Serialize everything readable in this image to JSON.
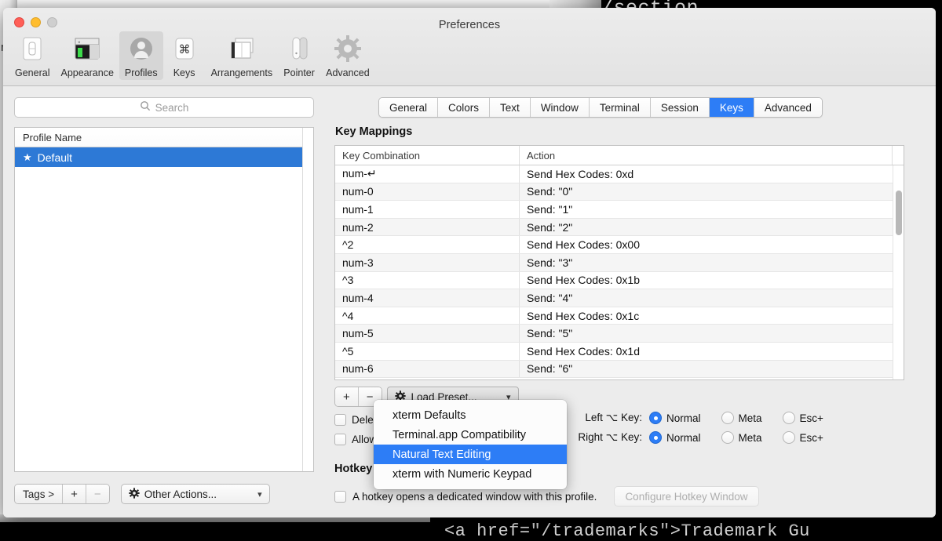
{
  "background": {
    "top_text": "/section",
    "bottom_text": "<a href=\"/trademarks\">Trademark Gu",
    "left_text": "m"
  },
  "window": {
    "title": "Preferences",
    "traffic_lights": [
      "close-button",
      "minimize-button",
      "zoom-button"
    ]
  },
  "toolbar": {
    "items": [
      {
        "label": "General",
        "icon": "general-icon"
      },
      {
        "label": "Appearance",
        "icon": "appearance-icon"
      },
      {
        "label": "Profiles",
        "icon": "profiles-icon",
        "selected": true
      },
      {
        "label": "Keys",
        "icon": "keys-icon"
      },
      {
        "label": "Arrangements",
        "icon": "arrangements-icon"
      },
      {
        "label": "Pointer",
        "icon": "pointer-icon"
      },
      {
        "label": "Advanced",
        "icon": "advanced-icon"
      }
    ]
  },
  "sidebar": {
    "search": {
      "placeholder": "Search",
      "value": ""
    },
    "table_header": "Profile Name",
    "profiles": [
      {
        "name": "Default",
        "starred": true,
        "selected": true
      }
    ],
    "footer": {
      "tags_label": "Tags >",
      "add_label": "+",
      "remove_label": "−",
      "other_actions_label": "Other Actions...",
      "other_actions_chevron": "chevron-down-icon"
    }
  },
  "tabs": [
    {
      "label": "General",
      "active": false
    },
    {
      "label": "Colors",
      "active": false
    },
    {
      "label": "Text",
      "active": false
    },
    {
      "label": "Window",
      "active": false
    },
    {
      "label": "Terminal",
      "active": false
    },
    {
      "label": "Session",
      "active": false
    },
    {
      "label": "Keys",
      "active": true
    },
    {
      "label": "Advanced",
      "active": false
    }
  ],
  "key_mappings": {
    "section_title": "Key Mappings",
    "columns": [
      "Key Combination",
      "Action"
    ],
    "rows": [
      {
        "key": "num-↵",
        "action": "Send Hex Codes: 0xd"
      },
      {
        "key": "num-0",
        "action": "Send: \"0\""
      },
      {
        "key": "num-1",
        "action": "Send: \"1\""
      },
      {
        "key": "num-2",
        "action": "Send: \"2\""
      },
      {
        "key": "^2",
        "action": "Send Hex Codes: 0x00"
      },
      {
        "key": "num-3",
        "action": "Send: \"3\""
      },
      {
        "key": "^3",
        "action": "Send Hex Codes: 0x1b"
      },
      {
        "key": "num-4",
        "action": "Send: \"4\""
      },
      {
        "key": "^4",
        "action": "Send Hex Codes: 0x1c"
      },
      {
        "key": "num-5",
        "action": "Send: \"5\""
      },
      {
        "key": "^5",
        "action": "Send Hex Codes: 0x1d"
      },
      {
        "key": "num-6",
        "action": "Send: \"6\""
      }
    ]
  },
  "preset_row": {
    "add_label": "+",
    "remove_label": "−",
    "gear_icon": "gear-icon",
    "load_preset_label": "Load Preset...",
    "chevron": "chevron-down-icon"
  },
  "preset_menu": {
    "items": [
      {
        "label": "xterm Defaults",
        "selected": false
      },
      {
        "label": "Terminal.app Compatibility",
        "selected": false
      },
      {
        "label": "Natural Text Editing",
        "selected": true
      },
      {
        "label": "xterm with Numeric Keypad",
        "selected": false
      }
    ]
  },
  "checkboxes": [
    {
      "label": "Delete key sends ^H",
      "checked": false
    },
    {
      "label": "Allow the mouse to move the cursor",
      "checked": false
    }
  ],
  "option_rows": [
    {
      "label": "Left ⌥ Key:",
      "options": [
        {
          "label": "Normal",
          "selected": true
        },
        {
          "label": "Meta",
          "selected": false
        },
        {
          "label": "Esc+",
          "selected": false
        }
      ]
    },
    {
      "label": "Right ⌥ Key:",
      "options": [
        {
          "label": "Normal",
          "selected": true
        },
        {
          "label": "Meta",
          "selected": false
        },
        {
          "label": "Esc+",
          "selected": false
        }
      ]
    }
  ],
  "hotkey": {
    "title": "Hotkey",
    "checkbox_label": "A hotkey opens a dedicated window with this profile.",
    "checkbox_checked": false,
    "button_label": "Configure Hotkey Window",
    "button_disabled": true
  },
  "colors": {
    "accent": "#2d7df6",
    "selection": "#2d79d6",
    "window_bg": "#ececec",
    "table_alt_row": "#f5f5f5"
  }
}
